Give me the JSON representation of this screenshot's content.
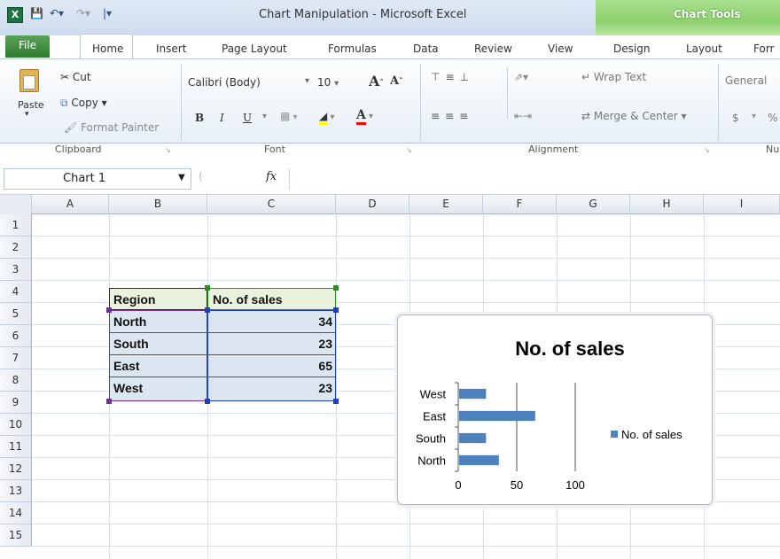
{
  "window": {
    "title": "Chart Manipulation - Microsoft Excel",
    "context_tab": "Chart Tools"
  },
  "tabs": [
    "File",
    "Home",
    "Insert",
    "Page Layout",
    "Formulas",
    "Data",
    "Review",
    "View",
    "Design",
    "Layout",
    "Forr"
  ],
  "ribbon": {
    "clipboard": {
      "paste": "Paste",
      "cut": "Cut",
      "copy": "Copy ▾",
      "format_painter": "Format Painter",
      "label": "Clipboard"
    },
    "font": {
      "font_name": "Calibri (Body)",
      "font_size": "10",
      "bold": "B",
      "italic": "I",
      "underline": "U",
      "label": "Font"
    },
    "alignment": {
      "wrap_text": "Wrap Text",
      "merge_center": "Merge & Center ▾",
      "label": "Alignment"
    },
    "number": {
      "format": "General",
      "currency": "$",
      "percent": "%",
      "label": "Nu"
    }
  },
  "formula_bar": {
    "name_box": "Chart 1",
    "fx": "fx",
    "formula": ""
  },
  "columns": [
    "A",
    "B",
    "C",
    "D",
    "E",
    "F",
    "G",
    "H",
    "I"
  ],
  "rows": [
    "1",
    "2",
    "3",
    "4",
    "5",
    "6",
    "7",
    "8",
    "9",
    "10",
    "11",
    "12",
    "13",
    "14",
    "15"
  ],
  "table": {
    "headers": [
      "Region",
      "No. of sales"
    ],
    "rows": [
      [
        "North",
        "34"
      ],
      [
        "South",
        "23"
      ],
      [
        "East",
        "65"
      ],
      [
        "West",
        "23"
      ]
    ]
  },
  "chart_data": {
    "type": "bar",
    "orientation": "horizontal",
    "title": "No. of sales",
    "categories": [
      "North",
      "South",
      "East",
      "West"
    ],
    "series": [
      {
        "name": "No. of sales",
        "values": [
          34,
          23,
          65,
          23
        ],
        "color": "#4f81bd"
      }
    ],
    "xlim": [
      0,
      100
    ],
    "xticks": [
      "0",
      "50",
      "100"
    ],
    "grid": true,
    "legend": "right"
  },
  "colors": {
    "selection_header": "#eaf1dd",
    "selection_body": "#dce6f1",
    "chart_tools": "#8fd06f",
    "file_tab": "#2d7d2d"
  }
}
